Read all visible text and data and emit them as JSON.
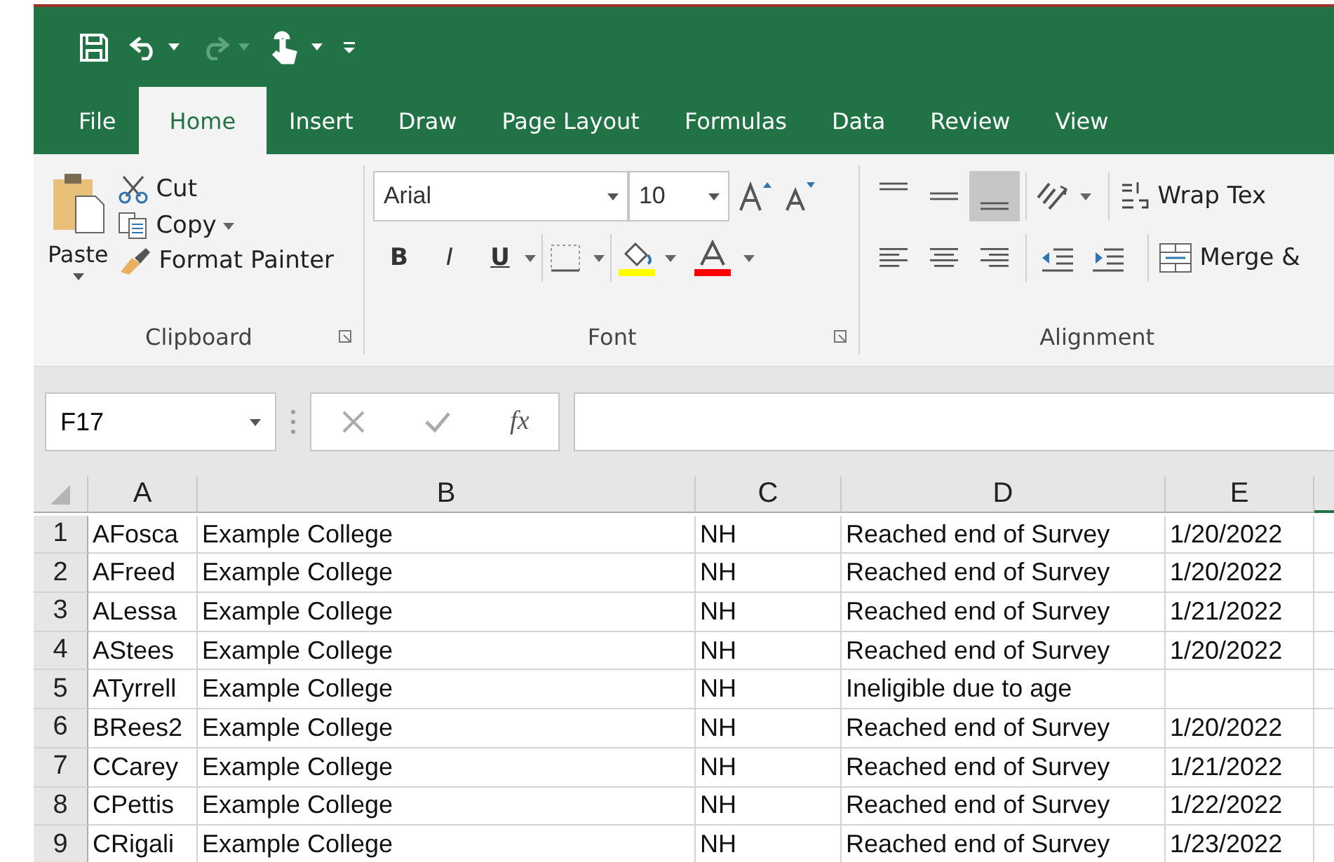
{
  "tabs": [
    {
      "label": "File",
      "selected": false
    },
    {
      "label": "Home",
      "selected": true
    },
    {
      "label": "Insert",
      "selected": false
    },
    {
      "label": "Draw",
      "selected": false
    },
    {
      "label": "Page Layout",
      "selected": false
    },
    {
      "label": "Formulas",
      "selected": false
    },
    {
      "label": "Data",
      "selected": false
    },
    {
      "label": "Review",
      "selected": false
    },
    {
      "label": "View",
      "selected": false
    }
  ],
  "clipboard": {
    "paste": "Paste",
    "cut": "Cut",
    "copy": "Copy",
    "format_painter": "Format Painter",
    "label": "Clipboard"
  },
  "font": {
    "font_name": "Arial",
    "font_size": "10",
    "bold": "B",
    "italic": "I",
    "underline": "U",
    "label": "Font"
  },
  "alignment": {
    "vertical_align": [
      {
        "selected": false
      },
      {
        "selected": false
      },
      {
        "selected": true
      }
    ],
    "wrap_text": "Wrap Tex",
    "merge": "Merge &",
    "label": "Alignment"
  },
  "formula_bar": {
    "name_box": "F17",
    "function_label": "fx"
  },
  "sheet": {
    "columns": [
      "A",
      "B",
      "C",
      "D",
      "E"
    ],
    "rows": [
      {
        "number": "1",
        "cells": [
          "AFosca",
          "Example College",
          "NH",
          "Reached end of Survey",
          "1/20/2022"
        ]
      },
      {
        "number": "2",
        "cells": [
          "AFreed",
          "Example College",
          "NH",
          "Reached end of Survey",
          "1/20/2022"
        ]
      },
      {
        "number": "3",
        "cells": [
          "ALessa",
          "Example College",
          "NH",
          "Reached end of Survey",
          "1/21/2022"
        ]
      },
      {
        "number": "4",
        "cells": [
          "AStees",
          "Example College",
          "NH",
          "Reached end of Survey",
          "1/20/2022"
        ]
      },
      {
        "number": "5",
        "cells": [
          "ATyrrell",
          "Example College",
          "NH",
          "Ineligible due to age",
          ""
        ]
      },
      {
        "number": "6",
        "cells": [
          "BRees2",
          "Example College",
          "NH",
          "Reached end of Survey",
          "1/20/2022"
        ]
      },
      {
        "number": "7",
        "cells": [
          "CCarey",
          "Example College",
          "NH",
          "Reached end of Survey",
          "1/21/2022"
        ]
      },
      {
        "number": "8",
        "cells": [
          "CPettis",
          "Example College",
          "NH",
          "Reached end of Survey",
          "1/22/2022"
        ]
      },
      {
        "number": "9",
        "cells": [
          "CRigali",
          "Example College",
          "NH",
          "Reached end of Survey",
          "1/23/2022"
        ]
      }
    ]
  }
}
